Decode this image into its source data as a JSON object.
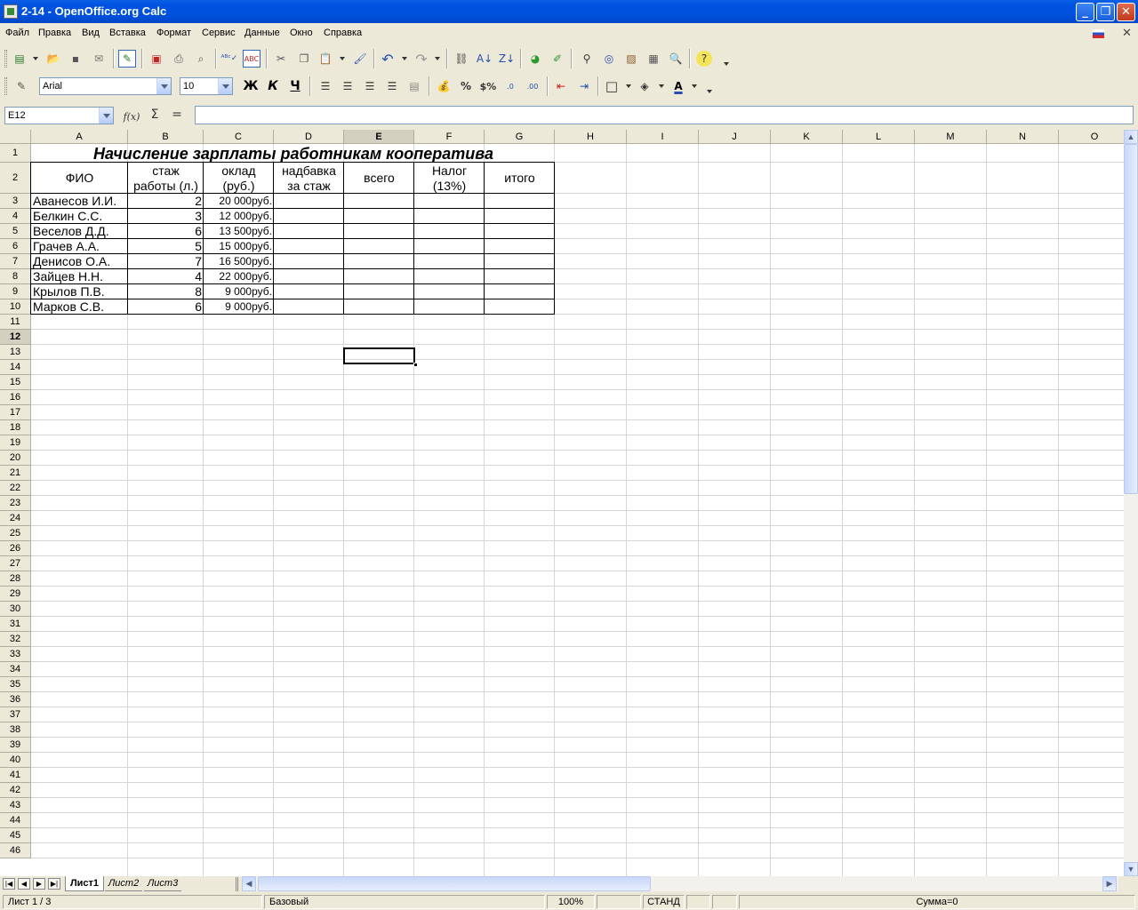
{
  "window": {
    "title": "2-14 - OpenOffice.org Calc"
  },
  "menu": {
    "items": [
      "Файл",
      "Правка",
      "Вид",
      "Вставка",
      "Формат",
      "Сервис",
      "Данные",
      "Окно",
      "Справка"
    ]
  },
  "format_bar": {
    "font_name": "Arial",
    "font_size": "10",
    "bold_label": "Ж",
    "italic_label": "К",
    "underline_label": "Ч"
  },
  "formula_bar": {
    "cell_ref": "E12",
    "function_label": "f(x)",
    "sum_label": "Σ",
    "equals_label": "=",
    "content": ""
  },
  "grid": {
    "columns": [
      "A",
      "B",
      "C",
      "D",
      "E",
      "F",
      "G",
      "H",
      "I",
      "J",
      "K",
      "L",
      "M",
      "N",
      "O"
    ],
    "selected_column": "E",
    "selected_row": 12,
    "selected_cell": "E12",
    "row_count": 46
  },
  "sheet": {
    "title": "Начисление зарплаты работникам кооператива",
    "headers": [
      [
        "ФИО"
      ],
      [
        "стаж",
        "работы (л.)"
      ],
      [
        "оклад",
        "(руб.)"
      ],
      [
        "надбавка",
        "за стаж"
      ],
      [
        "всего"
      ],
      [
        "Налог",
        "(13%)"
      ],
      [
        "итого"
      ]
    ],
    "rows": [
      {
        "name": "Аванесов И.И.",
        "exp": "2",
        "salary": "20 000руб."
      },
      {
        "name": "Белкин С.С.",
        "exp": "3",
        "salary": "12 000руб."
      },
      {
        "name": "Веселов Д.Д.",
        "exp": "6",
        "salary": "13 500руб."
      },
      {
        "name": "Грачев А.А.",
        "exp": "5",
        "salary": "15 000руб."
      },
      {
        "name": "Денисов О.А.",
        "exp": "7",
        "salary": "16 500руб."
      },
      {
        "name": "Зайцев Н.Н.",
        "exp": "4",
        "salary": "22 000руб."
      },
      {
        "name": "Крылов П.В.",
        "exp": "8",
        "salary": "9 000руб."
      },
      {
        "name": "Марков С.В.",
        "exp": "6",
        "salary": "9 000руб."
      }
    ]
  },
  "tabs": {
    "items": [
      "Лист1",
      "Лист2",
      "Лист3"
    ],
    "active": 0
  },
  "status": {
    "sheet": "Лист 1 / 3",
    "style": "Базовый",
    "zoom": "100%",
    "mode": "СТАНД",
    "sum": "Сумма=0"
  },
  "colors": {
    "titlebar": "#0053e0",
    "selection": "#000000",
    "header_bg": "#ece9d8"
  }
}
